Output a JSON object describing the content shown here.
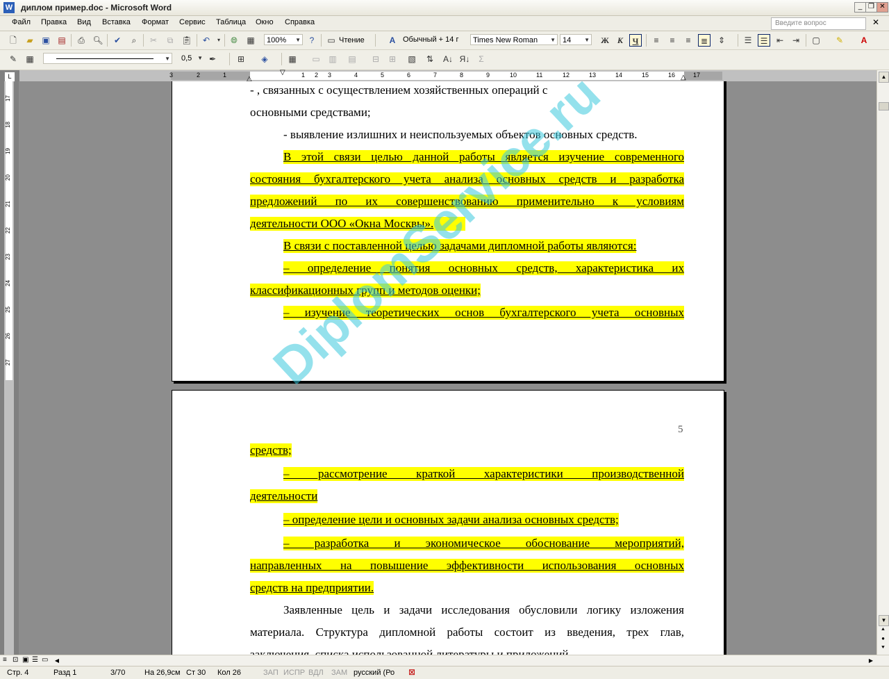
{
  "window": {
    "title": "диплом пример.doc - Microsoft Word"
  },
  "menu": {
    "items": [
      "Файл",
      "Правка",
      "Вид",
      "Вставка",
      "Формат",
      "Сервис",
      "Таблица",
      "Окно",
      "Справка"
    ],
    "help_placeholder": "Введите вопрос"
  },
  "toolbar": {
    "zoom": "100%",
    "read_label": "Чтение",
    "style": "Обычный + 14 г",
    "font": "Times New Roman",
    "size": "14",
    "bold": "Ж",
    "italic": "К",
    "underline": "Ч",
    "line_weight": "0,5"
  },
  "ruler": {
    "numbers": [
      "3",
      "2",
      "1",
      "1",
      "2",
      "3",
      "4",
      "5",
      "6",
      "7",
      "8",
      "9",
      "10",
      "11",
      "12",
      "13",
      "14",
      "15",
      "16",
      "17"
    ],
    "vertical_numbers": [
      "17",
      "18",
      "19",
      "20",
      "21",
      "22",
      "23",
      "24",
      "25",
      "26",
      "27"
    ]
  },
  "page1": {
    "lines": [
      "-   ,   связанных   с   осуществлением   хозяйственных   операций   с",
      "основными средствами;",
      "-   выявление излишних и неиспользуемых объектов основных средств.",
      "В этой связи целью данной работы является изучение современного",
      "состояния бухгалтерского учета анализа основных средств и разработка",
      "предложений по их совершенствованию применительно к условиям",
      "деятельности ООО «Окна Москвы».",
      "В связи с поставленной целью задачами дипломной работы являются:",
      "–      определение понятия основных средств, характеристика их",
      "классификационных групп и методов оценки;",
      "–      изучение теоретических основ бухгалтерского учета основных"
    ]
  },
  "page2": {
    "page_number": "5",
    "lines": [
      "средств;",
      "–      рассмотрение краткой характеристики производственной",
      "деятельности",
      "–      определение цели и основных задачи анализа основных средств;",
      "–      разработка и экономическое обоснование мероприятий,",
      "направленных на повышение эффективности использования основных",
      "средств на предприятии.",
      "Заявленные цель и задачи исследования обусловили логику изложения",
      "материала. Структура дипломной работы состоит из введения, трех глав,",
      "заключения, списка использованной литературы и приложений."
    ]
  },
  "watermark": "DiplomService.ru",
  "status": {
    "page": "Стр. 4",
    "section": "Разд 1",
    "count": "3/70",
    "at": "На 26,9см",
    "line": "Ст 30",
    "col": "Кол 26",
    "rec": "ЗАП",
    "trk": "ИСПР",
    "ext": "ВДЛ",
    "ovr": "ЗАМ",
    "lang": "русский (Ро"
  },
  "colors": {
    "highlight": "#ffff00",
    "watermark": "#3cc8dc"
  }
}
